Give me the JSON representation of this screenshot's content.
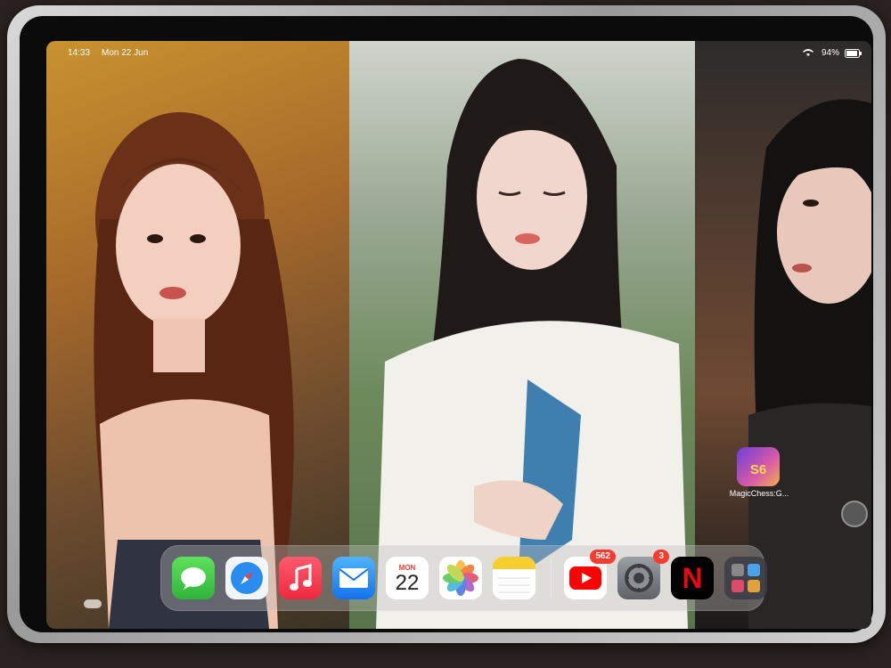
{
  "status_bar": {
    "time": "14:33",
    "date": "Mon 22 Jun",
    "battery": "94%"
  },
  "home_screen": {
    "app_icon": {
      "label": "MagicChess:G...",
      "icon": "magicchess-icon"
    }
  },
  "dock": {
    "apps": [
      {
        "name": "Messages",
        "icon": "messages-icon"
      },
      {
        "name": "Safari",
        "icon": "safari-icon"
      },
      {
        "name": "Music",
        "icon": "music-icon"
      },
      {
        "name": "Mail",
        "icon": "mail-icon"
      },
      {
        "name": "Calendar",
        "icon": "calendar-icon",
        "weekday": "MON",
        "day": "22"
      },
      {
        "name": "Photos",
        "icon": "photos-icon"
      },
      {
        "name": "Notes",
        "icon": "notes-icon"
      },
      {
        "name": "YouTube",
        "icon": "youtube-icon",
        "badge": "562"
      },
      {
        "name": "Settings",
        "icon": "settings-icon",
        "badge": "3"
      },
      {
        "name": "Netflix",
        "icon": "netflix-icon",
        "letter": "N"
      },
      {
        "name": "App Library",
        "icon": "app-library-icon"
      }
    ]
  }
}
